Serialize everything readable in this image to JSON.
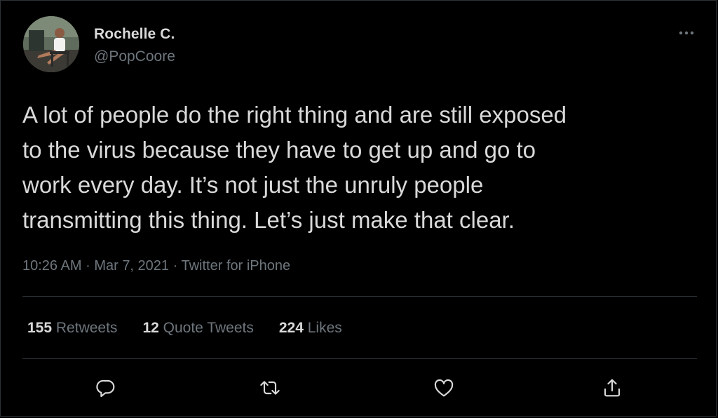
{
  "user": {
    "display_name": "Rochelle C.",
    "handle": "@PopCoore"
  },
  "tweet": {
    "text": "A lot of people do the right thing and are still exposed\nto the virus because they have to get up and go to\nwork every day. It’s not just the unruly people\ntransmitting this thing. Let’s just make that clear.",
    "time": "10:26 AM",
    "date": "Mar 7, 2021",
    "source": "Twitter for iPhone",
    "separator": "·"
  },
  "stats": {
    "retweets_count": "155",
    "retweets_label": "Retweets",
    "quotes_count": "12",
    "quotes_label": "Quote Tweets",
    "likes_count": "224",
    "likes_label": "Likes"
  },
  "icons": {
    "more": "more-icon",
    "reply": "reply-icon",
    "retweet": "retweet-icon",
    "like": "like-icon",
    "share": "share-icon"
  },
  "colors": {
    "background": "#000000",
    "text_primary": "#d9d9d9",
    "text_secondary": "#6e767d",
    "border": "#2f3336"
  }
}
